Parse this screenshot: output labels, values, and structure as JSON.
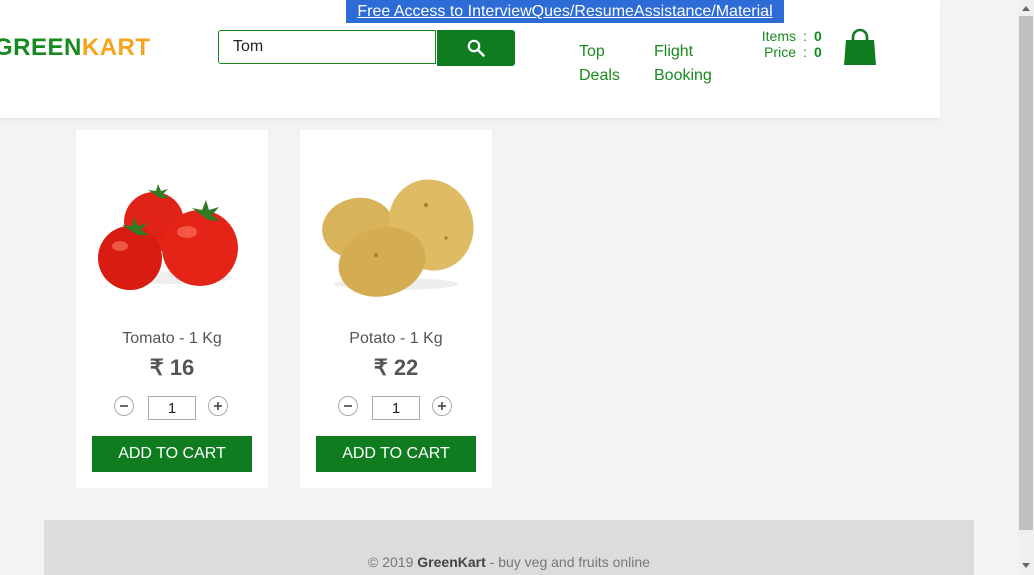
{
  "header": {
    "promo_text": "Free Access to InterviewQues/ResumeAssistance/Material",
    "logo_part1": "GREEN",
    "logo_part2": "KART",
    "search_value": "Tom",
    "nav": [
      {
        "label_line1": "Top",
        "label_line2": "Deals"
      },
      {
        "label_line1": "Flight",
        "label_line2": "Booking"
      }
    ],
    "cart": {
      "items_label": "Items",
      "items_value": "0",
      "price_label": "Price",
      "price_value": "0",
      "separator": ":"
    },
    "icons": {
      "search": "search-icon",
      "cart": "shopping-bag-icon"
    }
  },
  "products": [
    {
      "name": "Tomato - 1 Kg",
      "price": "₹ 16",
      "quantity": "1",
      "add_label": "ADD TO CART",
      "image": "tomato-image"
    },
    {
      "name": "Potato - 1 Kg",
      "price": "₹ 22",
      "quantity": "1",
      "add_label": "ADD TO CART",
      "image": "potato-image"
    }
  ],
  "footer": {
    "prefix": "© 2019 ",
    "brand": "GreenKart",
    "suffix": " - buy veg and fruits online"
  },
  "colors": {
    "brand_green": "#0f7d1f",
    "brand_orange": "#f7a31d",
    "promo_blue": "#2d6bd6"
  }
}
